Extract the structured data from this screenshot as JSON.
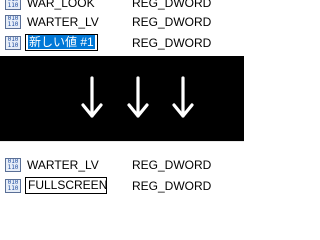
{
  "top_rows": [
    {
      "name": "WAR_LOOK",
      "type": "REG_DWORD"
    },
    {
      "name": "WARTER_LV",
      "type": "REG_DWORD"
    },
    {
      "name_selected": "新しい値 #1",
      "type": "REG_DWORD",
      "editing": true
    }
  ],
  "bottom_rows": [
    {
      "name": "WARTER_LV",
      "type": "REG_DWORD"
    },
    {
      "name": "FULLSCREEN",
      "type": "REG_DWORD",
      "editing": true
    }
  ],
  "icon": {
    "name": "registry-dword-icon",
    "glyph_lines": [
      "010",
      "110"
    ]
  },
  "band_color": "#000000",
  "arrow_color": "#ffffff",
  "selection_color": "#0078d7"
}
